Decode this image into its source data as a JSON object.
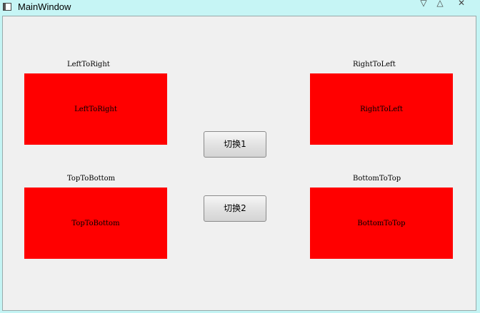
{
  "window": {
    "title": "MainWindow",
    "minimize_icon": "▽",
    "maximize_icon": "△",
    "close_icon": "✕"
  },
  "boxes": {
    "left_to_right": {
      "caption": "LeftToRight",
      "label": "LeftToRight"
    },
    "right_to_left": {
      "caption": "RightToLeft",
      "label": "RightToLeft"
    },
    "top_to_bottom": {
      "caption": "TopToBottom",
      "label": "TopToBottom"
    },
    "bottom_to_top": {
      "caption": "BottomToTop",
      "label": "BottomToTop"
    }
  },
  "buttons": {
    "switch1": "切换1",
    "switch2": "切换2"
  },
  "colors": {
    "box_fill": "#ff0000",
    "titlebar": "#c6f5f5",
    "client_bg": "#f0f0f0"
  }
}
